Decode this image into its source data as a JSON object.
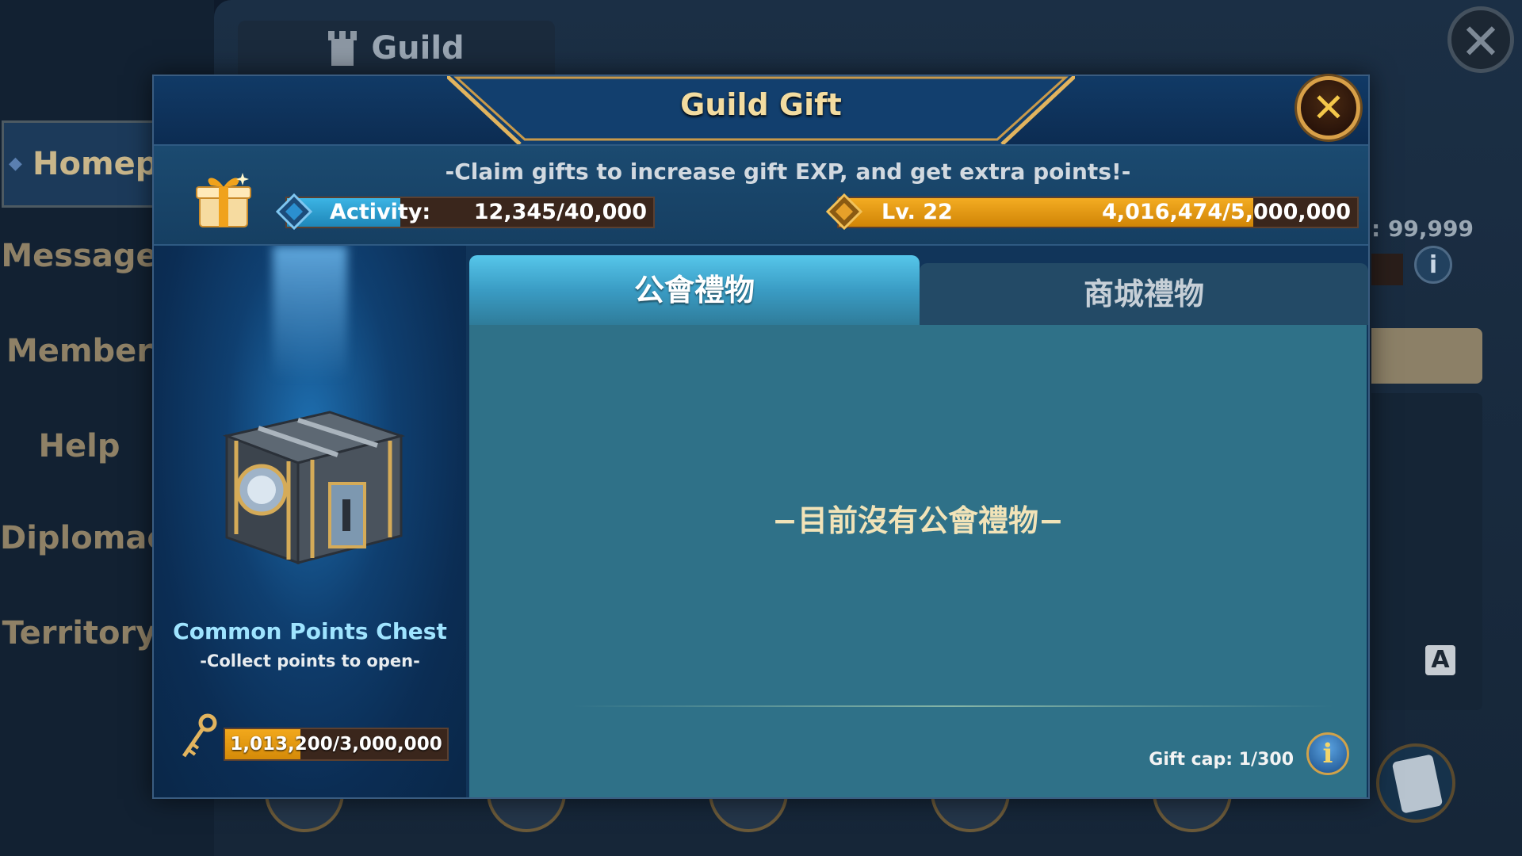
{
  "background": {
    "window_title": "Guild",
    "nav_items": [
      "Homepag",
      "Message",
      "Member",
      "Help",
      "Diplomac",
      "Territory"
    ],
    "points_text": ": 99,999",
    "translate_icon_letter": "A"
  },
  "modal": {
    "title": "Guild Gift",
    "close_symbol": "✕",
    "claim_text": "-Claim gifts to increase gift EXP, and get extra points!-",
    "activity": {
      "label": "Activity:",
      "value": "12,345/40,000",
      "fill_fraction": 0.31
    },
    "level": {
      "label": "Lv. 22",
      "value": "4,016,474/5,000,000",
      "fill_fraction": 0.8
    },
    "chest": {
      "name": "Common Points Chest",
      "subtitle": "-Collect points to open-",
      "progress": "1,013,200/3,000,000",
      "fill_fraction": 0.34
    },
    "tabs": [
      {
        "label": "公會禮物",
        "active": true
      },
      {
        "label": "商城禮物",
        "active": false
      }
    ],
    "empty_message": "−目前沒有公會禮物−",
    "gift_cap": "Gift cap: 1/300",
    "info_symbol": "i"
  },
  "colors": {
    "accent_gold": "#f3dca0",
    "activity_bar": "#2a9bcf",
    "level_bar": "#e0960c",
    "tab_active": "#3a9cc4",
    "content_bg": "#2f7188"
  }
}
